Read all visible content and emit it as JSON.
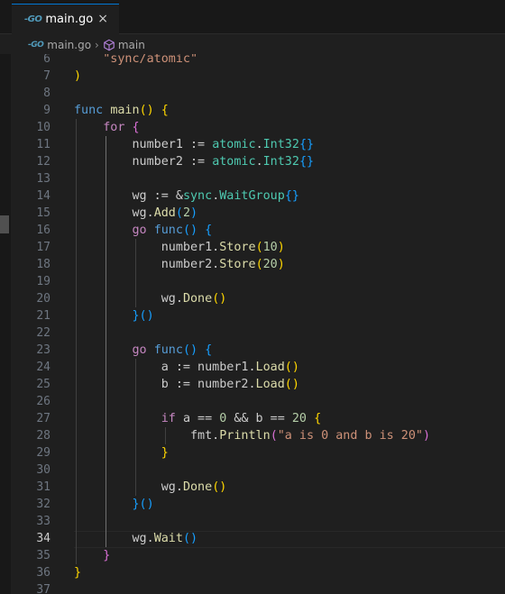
{
  "tab": {
    "icon": "go-file-icon",
    "icon_text": "-GO",
    "label": "main.go",
    "close": "×"
  },
  "breadcrumb": {
    "file_icon_text": "-GO",
    "file": "main.go",
    "separator": "›",
    "symbol": "main"
  },
  "editor": {
    "active_line": 34,
    "lines": [
      {
        "n": "6",
        "t": [
          [
            "    ",
            ""
          ],
          [
            "\"sync/atomic\"",
            "str"
          ]
        ]
      },
      {
        "n": "7",
        "t": [
          [
            ")",
            "b1"
          ]
        ]
      },
      {
        "n": "8",
        "t": []
      },
      {
        "n": "9",
        "t": [
          [
            "func ",
            "kb"
          ],
          [
            "main",
            "fn"
          ],
          [
            "()",
            "b1"
          ],
          [
            " ",
            ""
          ],
          [
            "{",
            "b1"
          ]
        ]
      },
      {
        "n": "10",
        "t": [
          [
            "    ",
            ""
          ],
          [
            "for ",
            "kw"
          ],
          [
            "{",
            "b2"
          ]
        ]
      },
      {
        "n": "11",
        "t": [
          [
            "        number1 := ",
            ""
          ],
          [
            "atomic",
            "ty"
          ],
          [
            ".",
            ""
          ],
          [
            "Int32",
            "ty"
          ],
          [
            "{}",
            "b3"
          ]
        ]
      },
      {
        "n": "12",
        "t": [
          [
            "        number2 := ",
            ""
          ],
          [
            "atomic",
            "ty"
          ],
          [
            ".",
            ""
          ],
          [
            "Int32",
            "ty"
          ],
          [
            "{}",
            "b3"
          ]
        ]
      },
      {
        "n": "13",
        "t": []
      },
      {
        "n": "14",
        "t": [
          [
            "        wg := &",
            ""
          ],
          [
            "sync",
            "ty"
          ],
          [
            ".",
            ""
          ],
          [
            "WaitGroup",
            "ty"
          ],
          [
            "{}",
            "b3"
          ]
        ]
      },
      {
        "n": "15",
        "t": [
          [
            "        wg.",
            ""
          ],
          [
            "Add",
            "fn"
          ],
          [
            "(",
            "b3"
          ],
          [
            "2",
            "num"
          ],
          [
            ")",
            "b3"
          ]
        ]
      },
      {
        "n": "16",
        "t": [
          [
            "        ",
            ""
          ],
          [
            "go ",
            "kw"
          ],
          [
            "func",
            "kb"
          ],
          [
            "()",
            "b3"
          ],
          [
            " ",
            ""
          ],
          [
            "{",
            "b3"
          ]
        ]
      },
      {
        "n": "17",
        "t": [
          [
            "            number1.",
            ""
          ],
          [
            "Store",
            "fn"
          ],
          [
            "(",
            "b1"
          ],
          [
            "10",
            "num"
          ],
          [
            ")",
            "b1"
          ]
        ]
      },
      {
        "n": "18",
        "t": [
          [
            "            number2.",
            ""
          ],
          [
            "Store",
            "fn"
          ],
          [
            "(",
            "b1"
          ],
          [
            "20",
            "num"
          ],
          [
            ")",
            "b1"
          ]
        ]
      },
      {
        "n": "19",
        "t": []
      },
      {
        "n": "20",
        "t": [
          [
            "            wg.",
            ""
          ],
          [
            "Done",
            "fn"
          ],
          [
            "()",
            "b1"
          ]
        ]
      },
      {
        "n": "21",
        "t": [
          [
            "        ",
            ""
          ],
          [
            "}()",
            "b3"
          ]
        ]
      },
      {
        "n": "22",
        "t": []
      },
      {
        "n": "23",
        "t": [
          [
            "        ",
            ""
          ],
          [
            "go ",
            "kw"
          ],
          [
            "func",
            "kb"
          ],
          [
            "()",
            "b3"
          ],
          [
            " ",
            ""
          ],
          [
            "{",
            "b3"
          ]
        ]
      },
      {
        "n": "24",
        "t": [
          [
            "            a := number1.",
            ""
          ],
          [
            "Load",
            "fn"
          ],
          [
            "()",
            "b1"
          ]
        ]
      },
      {
        "n": "25",
        "t": [
          [
            "            b := number2.",
            ""
          ],
          [
            "Load",
            "fn"
          ],
          [
            "()",
            "b1"
          ]
        ]
      },
      {
        "n": "26",
        "t": []
      },
      {
        "n": "27",
        "t": [
          [
            "            ",
            ""
          ],
          [
            "if ",
            "kw"
          ],
          [
            "a == ",
            ""
          ],
          [
            "0",
            "num"
          ],
          [
            " && b == ",
            ""
          ],
          [
            "20",
            "num"
          ],
          [
            " ",
            ""
          ],
          [
            "{",
            "b1"
          ]
        ]
      },
      {
        "n": "28",
        "t": [
          [
            "                fmt.",
            ""
          ],
          [
            "Println",
            "fn"
          ],
          [
            "(",
            "b2"
          ],
          [
            "\"a is 0 and b is 20\"",
            "str"
          ],
          [
            ")",
            "b2"
          ]
        ]
      },
      {
        "n": "29",
        "t": [
          [
            "            ",
            ""
          ],
          [
            "}",
            "b1"
          ]
        ]
      },
      {
        "n": "30",
        "t": []
      },
      {
        "n": "31",
        "t": [
          [
            "            wg.",
            ""
          ],
          [
            "Done",
            "fn"
          ],
          [
            "()",
            "b1"
          ]
        ]
      },
      {
        "n": "32",
        "t": [
          [
            "        ",
            ""
          ],
          [
            "}()",
            "b3"
          ]
        ]
      },
      {
        "n": "33",
        "t": []
      },
      {
        "n": "34",
        "t": [
          [
            "        wg.",
            ""
          ],
          [
            "Wait",
            "fn"
          ],
          [
            "()",
            "b3"
          ]
        ]
      },
      {
        "n": "35",
        "t": [
          [
            "    ",
            ""
          ],
          [
            "}",
            "b2"
          ]
        ]
      },
      {
        "n": "36",
        "t": [
          [
            "}",
            "b1"
          ]
        ]
      },
      {
        "n": "37",
        "t": []
      }
    ]
  }
}
